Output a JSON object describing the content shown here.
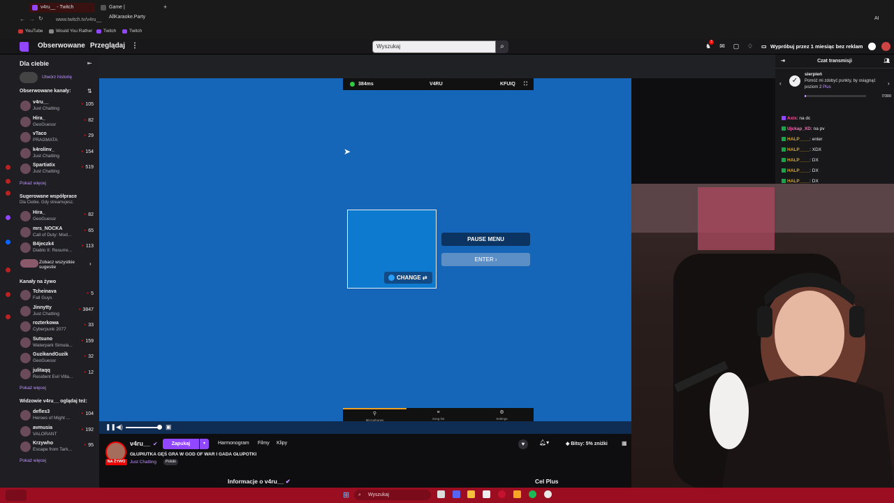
{
  "browser": {
    "tabs": [
      {
        "label": "v4ru__ - Twitch",
        "active": true
      },
      {
        "label": "Game | AllKaraoke.Party",
        "active": false
      }
    ],
    "address": "www.twitch.tv/v4ru__",
    "bookmarks": [
      "YouTube",
      "Would You Rather",
      "Twitch",
      "Twitch"
    ],
    "right_label": "AI"
  },
  "topnav": {
    "following": "Obserwowane",
    "browse": "Przeglądaj",
    "more": "⋮",
    "search_placeholder": "Wyszukaj",
    "notif_count": "3",
    "promo": "Wypróbuj przez 1 miesiąc bez reklam"
  },
  "sidebar": {
    "title": "Dla ciebie",
    "create_history": "Utwórz historię",
    "followed_heading": "Obserwowane kanały:",
    "followed": [
      {
        "name": "v4ru__",
        "game": "Just Chatting",
        "viewers": "105"
      },
      {
        "name": "Hira_",
        "game": "GeoGuessr",
        "viewers": "82"
      },
      {
        "name": "vTaco",
        "game": "PRAGMATA",
        "viewers": "29"
      },
      {
        "name": "k4rolinv_",
        "game": "Just Chatting",
        "viewers": "154"
      },
      {
        "name": "Spartiatix",
        "game": "Just Chatting",
        "viewers": "519"
      }
    ],
    "show_more_1": "Pokaż więcej",
    "collab_heading": "Sugerowane współprace",
    "collab_sub": "Dla Ciebie. Gdy streamujesz.",
    "collab": [
      {
        "name": "Hira_",
        "game": "GeoGuessr",
        "viewers": "82"
      },
      {
        "name": "mrs_NOCKA",
        "game": "Call of Duty: Mod...",
        "viewers": "65"
      },
      {
        "name": "B4jeczk4",
        "game": "Diablo II: Resurre...",
        "viewers": "113"
      }
    ],
    "see_all_1": "Zobacz wszystkie",
    "see_all_2": "sugestie",
    "live_heading": "Kanały na żywo",
    "live": [
      {
        "name": "Tcheinava",
        "game": "Fall Guys",
        "viewers": "5"
      },
      {
        "name": "Jinnytty",
        "game": "Just Chatting",
        "viewers": "3847"
      },
      {
        "name": "rozterkowa",
        "game": "Cyberpunk 2077",
        "viewers": "33"
      },
      {
        "name": "Sutsuno",
        "game": "Waterpark Simula...",
        "viewers": "159"
      },
      {
        "name": "GuzikandGuzik",
        "game": "GeoGuessr",
        "viewers": "32"
      },
      {
        "name": "julitaqq",
        "game": "Resident Evil Villa...",
        "viewers": "12"
      }
    ],
    "show_more_2": "Pokaż więcej",
    "also_heading": "Widzowie v4ru__ oglądaj też:",
    "also": [
      {
        "name": "defles3",
        "game": "Heroes of Might ...",
        "viewers": "104"
      },
      {
        "name": "avmusia",
        "game": "VALORANT",
        "viewers": "192"
      },
      {
        "name": "Krzywho",
        "game": "Escape from Tark...",
        "viewers": "95"
      }
    ],
    "show_more_3": "Pokaż więcej"
  },
  "game": {
    "ping": "384ms",
    "player": "V4RU",
    "room": "KFUIQ",
    "change": "CHANGE",
    "pause_menu": "PAUSE MENU",
    "enter": "ENTER",
    "bottom_tabs": [
      "Microphones",
      "Song list",
      "Settings"
    ]
  },
  "stream": {
    "name": "v4ru__",
    "follow": "Zapukaj",
    "tabs": [
      "Harmonogram",
      "Filmy",
      "Klipy"
    ],
    "title": "GŁUPIUTKA GĘŚ GRA W GOD OF WAR I GADA GŁUPOTKI",
    "live": "NA ŻYWO",
    "category": "Just Chatting",
    "tag": "Polski",
    "bits": "Bitsy: 5% zniżki",
    "about": "Informacje o v4ru__",
    "goal_section": "Cel Plus"
  },
  "chat": {
    "header": "Czat transmisji",
    "goal_title": "sierpień",
    "goal_desc_1": "Pomóż mi zdobyć punkty, by osiągnąć poziom 2",
    "goal_desc_plus": "Plus",
    "goal_count": "7/300",
    "goal_progress": 0.023,
    "messages": [
      {
        "user": "Axix",
        "text": ": na dc",
        "color": "#ff4f9a"
      },
      {
        "user": "Ujckap_XD",
        "text": ": na pv",
        "color": "#ff69b4"
      },
      {
        "user": "HALP____",
        "text": ": enter",
        "color": "#daa520"
      },
      {
        "user": "HALP____",
        "text": ": XDX",
        "color": "#daa520"
      },
      {
        "user": "HALP____",
        "text": ": DX",
        "color": "#daa520"
      },
      {
        "user": "HALP____",
        "text": ": DX",
        "color": "#daa520"
      },
      {
        "user": "HALP____",
        "text": ": DX",
        "color": "#daa520"
      }
    ]
  },
  "taskbar": {
    "search": "Wyszukaj"
  },
  "colors": {
    "twitch_purple": "#9147ff",
    "live_red": "#eb0400",
    "game_blue": "#1565b8",
    "taskbar": "#9b0e22"
  }
}
